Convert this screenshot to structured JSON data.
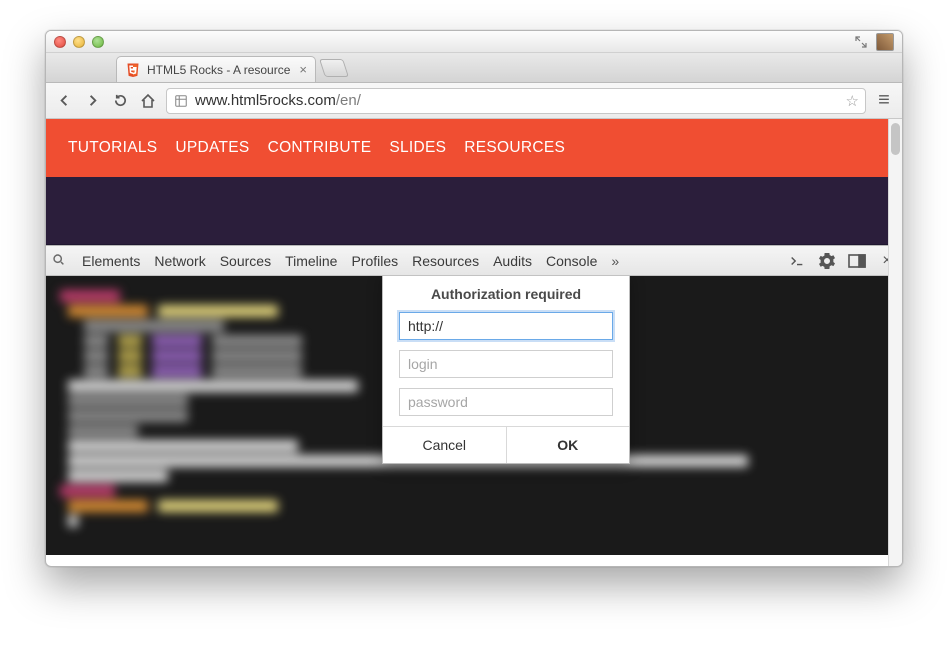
{
  "browser": {
    "tab_title": "HTML5 Rocks - A resource",
    "url_host": "www.html5rocks.com",
    "url_path": "/en/"
  },
  "site": {
    "nav": [
      "TUTORIALS",
      "UPDATES",
      "CONTRIBUTE",
      "SLIDES",
      "RESOURCES"
    ]
  },
  "devtools": {
    "tabs": [
      "Elements",
      "Network",
      "Sources",
      "Timeline",
      "Profiles",
      "Resources",
      "Audits",
      "Console"
    ]
  },
  "dialog": {
    "title": "Authorization required",
    "url_value": "http://",
    "login_placeholder": "login",
    "password_placeholder": "password",
    "cancel": "Cancel",
    "ok": "OK"
  }
}
